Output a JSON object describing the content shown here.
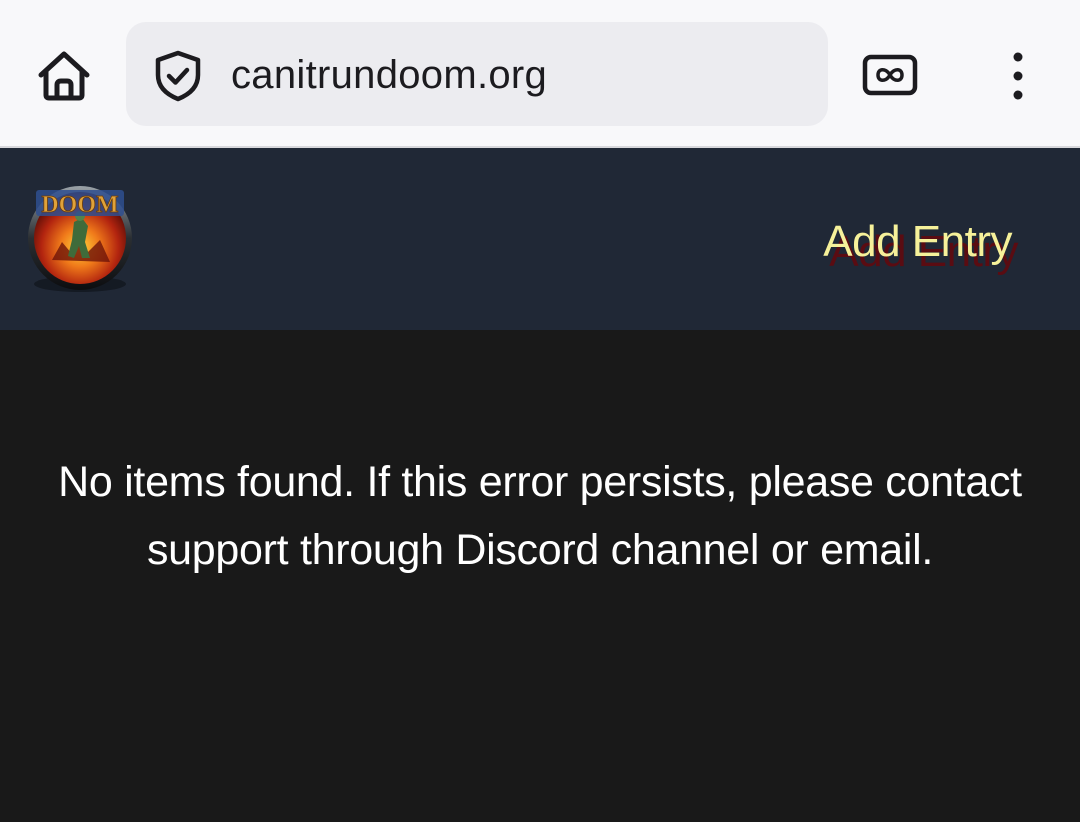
{
  "browser": {
    "url": "canitrundoom.org",
    "home_icon": "home-icon",
    "security_icon": "shield-check-icon",
    "tabs_icon": "tab-switcher-icon",
    "menu_icon": "more-vert-icon",
    "bar_color": "#f8f8fa",
    "url_box_color": "#ececf0"
  },
  "header": {
    "logo_icon": "doom-logo",
    "logo_text": "DOOM",
    "add_entry_label": "Add Entry",
    "background": "#202836",
    "link_color": "#f6f19a"
  },
  "main": {
    "message": "No items found. If this error persists, please contact support through Discord channel or email.",
    "background": "#191919"
  }
}
